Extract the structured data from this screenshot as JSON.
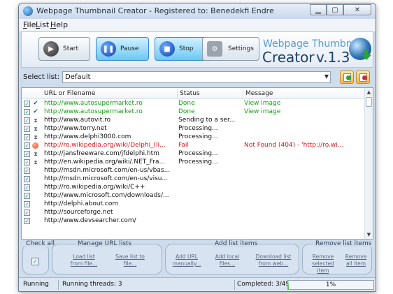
{
  "window": {
    "title": "Webpage Thumbnail Creator - Registered to: Benedekfi Endre",
    "controls": [
      "minimize-icon",
      "maximize-icon",
      "close-icon"
    ]
  },
  "menu": [
    "File",
    "List",
    "Help"
  ],
  "toolbar": {
    "start": "Start",
    "pause": "Pause",
    "stop": "Stop",
    "settings": "Settings"
  },
  "logo": {
    "line1": "Webpage Thumbnail",
    "line2": "Creator",
    "version": "v.1.3"
  },
  "select": {
    "label": "Select list:",
    "value": "Default"
  },
  "table": {
    "columns": [
      "URL or Filename",
      "Status",
      "Message"
    ],
    "rows": [
      {
        "url": "http://www.autosupermarket.ro",
        "status": "Done",
        "message": "View image",
        "state": "done"
      },
      {
        "url": "http://www.autosupermarket.ro",
        "status": "Done",
        "message": "View image",
        "state": "done"
      },
      {
        "url": "http://www.autovit.ro",
        "status": "Sending to a ser...",
        "message": "",
        "state": "proc"
      },
      {
        "url": "http://www.torry.net",
        "status": "Processing...",
        "message": "",
        "state": "proc"
      },
      {
        "url": "http://www.delphi3000.com",
        "status": "Processing...",
        "message": "",
        "state": "proc"
      },
      {
        "url": "http://ro.wikipedia.org/wiki/Delphi_(li...",
        "status": "Fail",
        "message": "Not Found (404) - 'http://ro.wi...",
        "state": "fail"
      },
      {
        "url": "http://jansfreeware.com/jfdelphi.htm",
        "status": "Processing...",
        "message": "",
        "state": "proc"
      },
      {
        "url": "http://en.wikipedia.org/wiki/.NET_Fra...",
        "status": "Processing...",
        "message": "",
        "state": "proc"
      },
      {
        "url": "http://msdn.microsoft.com/en-us/vbas...",
        "status": "",
        "message": "",
        "state": "none"
      },
      {
        "url": "http://msdn.microsoft.com/en-us/visu...",
        "status": "",
        "message": "",
        "state": "none"
      },
      {
        "url": "http://ro.wikipedia.org/wiki/C++",
        "status": "",
        "message": "",
        "state": "none"
      },
      {
        "url": "http://www.microsoft.com/downloads/...",
        "status": "",
        "message": "",
        "state": "none"
      },
      {
        "url": "http://delphi.about.com",
        "status": "",
        "message": "",
        "state": "none"
      },
      {
        "url": "http://sourceforge.net",
        "status": "",
        "message": "",
        "state": "none"
      },
      {
        "url": "http://www.devsearcher.com/",
        "status": "",
        "message": "",
        "state": "none"
      }
    ]
  },
  "groups": {
    "check_all": "Check all",
    "manage": {
      "title": "Manage URL lists",
      "load": "Load list from file...",
      "save": "Save list to file..."
    },
    "add": {
      "title": "Add list items",
      "add_url": "Add URL manually...",
      "add_local": "Add local files...",
      "download": "Download list from web..."
    },
    "remove": {
      "title": "Remove list items",
      "selected": "Remove selected item",
      "all": "Remove all item"
    }
  },
  "status": {
    "state": "Running",
    "threads": "Running threads: 3",
    "completed": "Completed: 3/493",
    "percent_text": "1%",
    "progress": 0.01
  },
  "colors": {
    "done": "#13a013",
    "fail": "#e01515",
    "accent": "#3a89c9"
  }
}
